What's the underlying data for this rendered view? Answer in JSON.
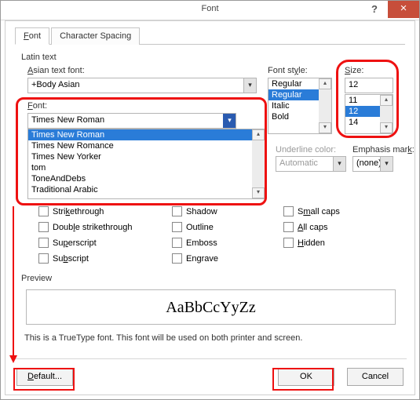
{
  "title": "Font",
  "tabs": {
    "font": "Font",
    "spacing": "Character Spacing"
  },
  "labels": {
    "latin": "Latin text",
    "asian": "Asian text font:",
    "fontstyle": "Font style:",
    "size": "Size:",
    "font": "Font:",
    "underline": "Underline color:",
    "emphasis": "Emphasis mark:",
    "preview": "Preview"
  },
  "values": {
    "asian": "+Body Asian",
    "font": "Times New Roman",
    "size_input": "12",
    "underline": "Automatic",
    "emphasis": "(none)"
  },
  "fontstyle_list": [
    "Regular",
    "Regular",
    "Italic",
    "Bold"
  ],
  "fontstyle_selected_index": 1,
  "size_list": [
    "11",
    "12",
    "14"
  ],
  "size_selected_index": 1,
  "font_list": [
    "Times New Roman",
    "Times New Romance",
    "Times New Yorker",
    "tom",
    "ToneAndDebs",
    "Traditional Arabic"
  ],
  "font_selected_index": 0,
  "checks": {
    "strike": "Strikethrough",
    "dstrike": "Double strikethrough",
    "supersc": "Superscript",
    "subsc": "Subscript",
    "shadow": "Shadow",
    "outline": "Outline",
    "emboss": "Emboss",
    "engrave": "Engrave",
    "small": "Small caps",
    "allcaps": "All caps",
    "hidden": "Hidden"
  },
  "preview_sample": "AaBbCcYyZz",
  "note": "This is a TrueType font. This font will be used on both printer and screen.",
  "buttons": {
    "default": "Default...",
    "ok": "OK",
    "cancel": "Cancel"
  }
}
